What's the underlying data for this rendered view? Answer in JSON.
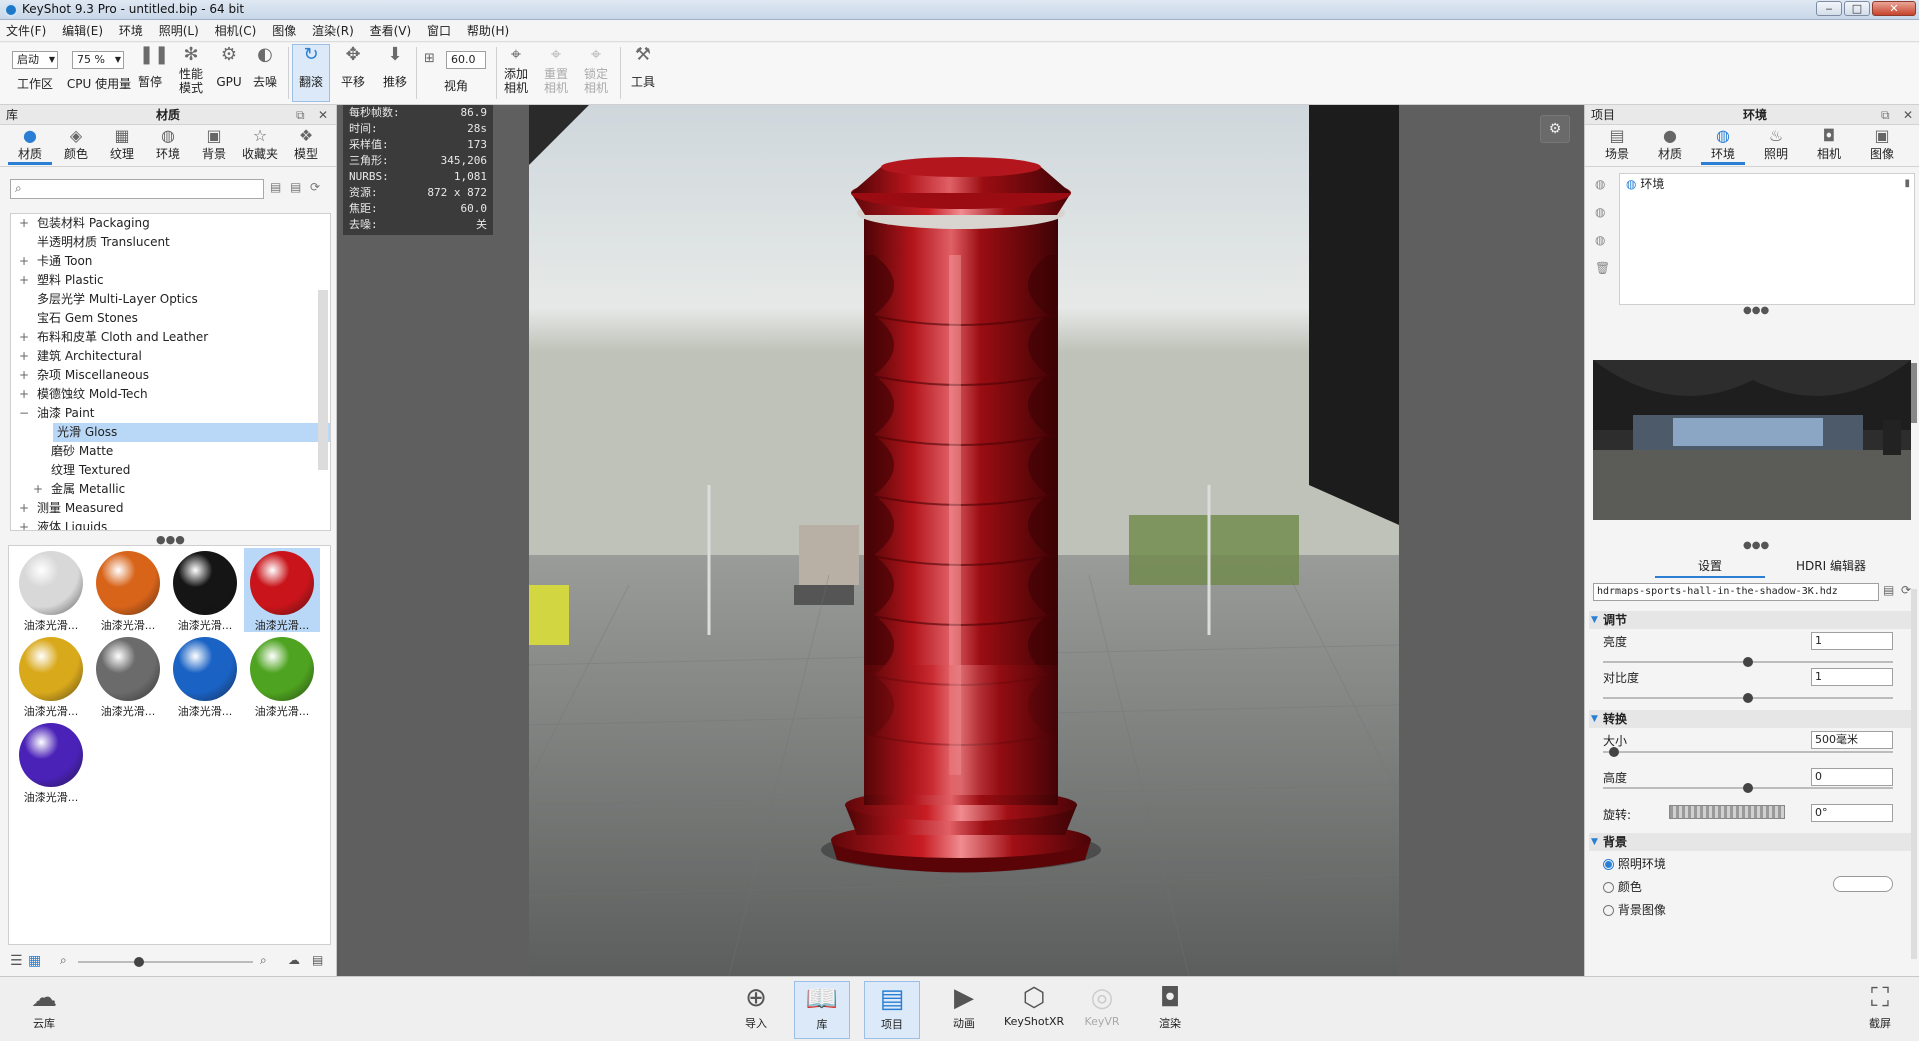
{
  "window": {
    "title": "KeyShot 9.3 Pro  - untitled.bip  - 64 bit",
    "min": "‒",
    "max": "□",
    "close": "✕"
  },
  "menu": [
    "文件(F)",
    "编辑(E)",
    "环境",
    "照明(L)",
    "相机(C)",
    "图像",
    "渲染(R)",
    "查看(V)",
    "窗口",
    "帮助(H)"
  ],
  "toolbar": {
    "workspace_select": "启动",
    "workspace_label": "工作区",
    "cpu_select": "75 %",
    "cpu_label": "CPU 使用量",
    "pause": "暂停",
    "perf_mode_1": "性能",
    "perf_mode_2": "模式",
    "gpu": "GPU",
    "denoise": "去噪",
    "tumble": "翻滚",
    "pan": "平移",
    "dolly": "推移",
    "fov_value": "60.0",
    "fov_label": "视角",
    "add_camera_1": "添加",
    "add_camera_2": "相机",
    "reset_camera_1": "重置",
    "reset_camera_2": "相机",
    "lock_camera_1": "锁定",
    "lock_camera_2": "相机",
    "tools": "工具"
  },
  "library": {
    "header_left": "库",
    "header_title": "材质",
    "tabs": [
      "材质",
      "颜色",
      "纹理",
      "环境",
      "背景",
      "收藏夹",
      "模型"
    ],
    "tree": [
      {
        "label": "包装材料 Packaging",
        "pm": "+",
        "indent": 0
      },
      {
        "label": "半透明材质 Translucent",
        "pm": "",
        "indent": 0
      },
      {
        "label": "卡通 Toon",
        "pm": "+",
        "indent": 0
      },
      {
        "label": "塑料 Plastic",
        "pm": "+",
        "indent": 0
      },
      {
        "label": "多层光学 Multi-Layer Optics",
        "pm": "",
        "indent": 0
      },
      {
        "label": "宝石 Gem Stones",
        "pm": "",
        "indent": 0
      },
      {
        "label": "布料和皮革 Cloth and Leather",
        "pm": "+",
        "indent": 0
      },
      {
        "label": "建筑 Architectural",
        "pm": "+",
        "indent": 0
      },
      {
        "label": "杂项 Miscellaneous",
        "pm": "+",
        "indent": 0
      },
      {
        "label": "模德蚀纹 Mold-Tech",
        "pm": "+",
        "indent": 0
      },
      {
        "label": "油漆 Paint",
        "pm": "−",
        "indent": 0
      },
      {
        "label": "光滑 Gloss",
        "pm": "",
        "indent": 1,
        "selected": true
      },
      {
        "label": "磨砂 Matte",
        "pm": "",
        "indent": 1
      },
      {
        "label": "纹理 Textured",
        "pm": "",
        "indent": 1
      },
      {
        "label": "金属 Metallic",
        "pm": "+",
        "indent": 1
      },
      {
        "label": "测量 Measured",
        "pm": "+",
        "indent": 0
      },
      {
        "label": "液体 Liquids",
        "pm": "+",
        "indent": 0
      }
    ],
    "thumbs": [
      {
        "label": "油漆光滑...",
        "color": "#d8d8d8"
      },
      {
        "label": "油漆光滑...",
        "color": "#d8641a"
      },
      {
        "label": "油漆光滑...",
        "color": "#151515"
      },
      {
        "label": "油漆光滑...",
        "color": "#c8141a",
        "selected": true
      },
      {
        "label": "油漆光滑...",
        "color": "#d9a91c"
      },
      {
        "label": "油漆光滑...",
        "color": "#6b6b6b"
      },
      {
        "label": "油漆光滑...",
        "color": "#1a62c4"
      },
      {
        "label": "油漆光滑...",
        "color": "#4ea320"
      },
      {
        "label": "油漆光滑...",
        "color": "#4a22b8"
      }
    ]
  },
  "hud": [
    {
      "k": "每秒帧数:",
      "v": "86.9"
    },
    {
      "k": "时间:",
      "v": "28s"
    },
    {
      "k": "采样值:",
      "v": "173"
    },
    {
      "k": "三角形:",
      "v": "345,206"
    },
    {
      "k": "NURBS:",
      "v": "1,081"
    },
    {
      "k": "资源:",
      "v": "872 x 872"
    },
    {
      "k": "焦距:",
      "v": "60.0"
    },
    {
      "k": "去噪:",
      "v": "关"
    }
  ],
  "project": {
    "header_left": "项目",
    "header_title": "环境",
    "tabs": [
      "场景",
      "材质",
      "环境",
      "照明",
      "相机",
      "图像"
    ],
    "env_item": "环境",
    "subtabs": [
      "设置",
      "HDRI 编辑器"
    ],
    "hdr_file": "hdrmaps-sports-hall-in-the-shadow-3K.hdz",
    "sections": {
      "adjust": "调节",
      "transform": "转换",
      "background": "背景"
    },
    "brightness_label": "亮度",
    "brightness_value": "1",
    "brightness_level": 0.5,
    "contrast_label": "对比度",
    "contrast_value": "1",
    "contrast_level": 0.5,
    "size_label": "大小",
    "size_value": "500毫米",
    "size_level": 0.02,
    "height_label": "高度",
    "height_value": "0",
    "height_level": 0.5,
    "rotation_label": "旋转:",
    "rotation_value": "0°",
    "bg_options": [
      {
        "label": "照明环境",
        "checked": true
      },
      {
        "label": "颜色",
        "checked": false
      },
      {
        "label": "背景图像",
        "checked": false
      }
    ]
  },
  "bottom": {
    "cloud": "云库",
    "import": "导入",
    "library": "库",
    "project": "项目",
    "animation": "动画",
    "keyshotxr": "KeyShotXR",
    "keyvr": "KeyVR",
    "render": "渲染",
    "screenshot": "截屏"
  },
  "colors": {
    "accent": "#2a7fd4",
    "object": "#8e0d12"
  }
}
